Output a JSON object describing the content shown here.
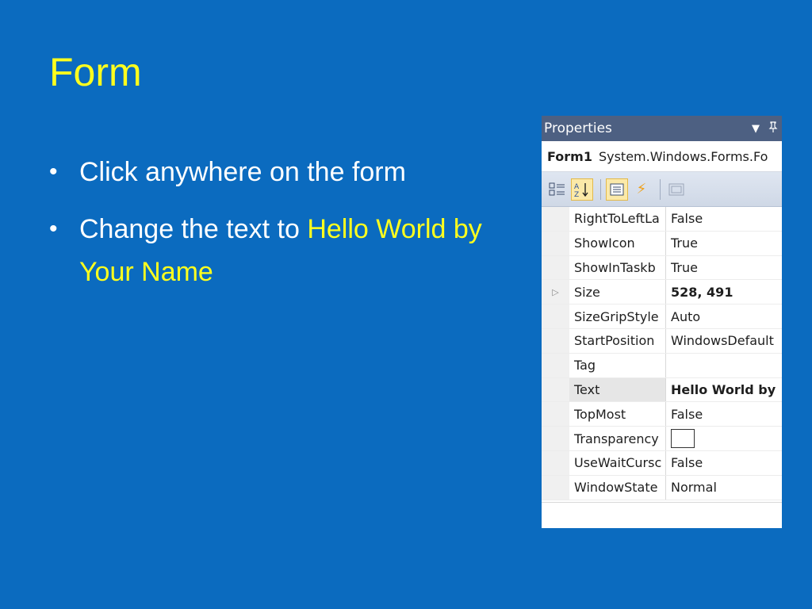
{
  "slide": {
    "title": "Form",
    "bullets": [
      {
        "text": "Click anywhere on the form"
      },
      {
        "text": "Change the text to ",
        "highlight": "Hello World by Your Name"
      }
    ],
    "colors": {
      "background": "#0b6bbf",
      "title": "#ffff1e",
      "body": "#ffffff",
      "highlight": "#ffff1e"
    }
  },
  "properties_panel": {
    "title": "Properties",
    "titlebar_icons": [
      "dropdown-arrow-icon",
      "pin-icon"
    ],
    "object_name": "Form1",
    "object_type": "System.Windows.Forms.Fo",
    "toolbar": [
      "categorized-icon",
      "alphabetical-icon",
      "properties-icon",
      "events-icon",
      "property-pages-icon"
    ],
    "rows": [
      {
        "name": "RightToLeftLa",
        "value": "False",
        "bold": false
      },
      {
        "name": "ShowIcon",
        "value": "True",
        "bold": false
      },
      {
        "name": "ShowInTaskb",
        "value": "True",
        "bold": false
      },
      {
        "name": "Size",
        "value": "528, 491",
        "bold": true,
        "expandable": true
      },
      {
        "name": "SizeGripStyle",
        "value": "Auto",
        "bold": false
      },
      {
        "name": "StartPosition",
        "value": "WindowsDefault",
        "bold": false
      },
      {
        "name": "Tag",
        "value": "",
        "bold": false
      },
      {
        "name": "Text",
        "value": "Hello World by",
        "bold": true,
        "selected": true
      },
      {
        "name": "TopMost",
        "value": "False",
        "bold": false
      },
      {
        "name": "Transparency",
        "value": "",
        "bold": false,
        "swatch": true
      },
      {
        "name": "UseWaitCursc",
        "value": "False",
        "bold": false
      },
      {
        "name": "WindowState",
        "value": "Normal",
        "bold": false
      }
    ]
  }
}
